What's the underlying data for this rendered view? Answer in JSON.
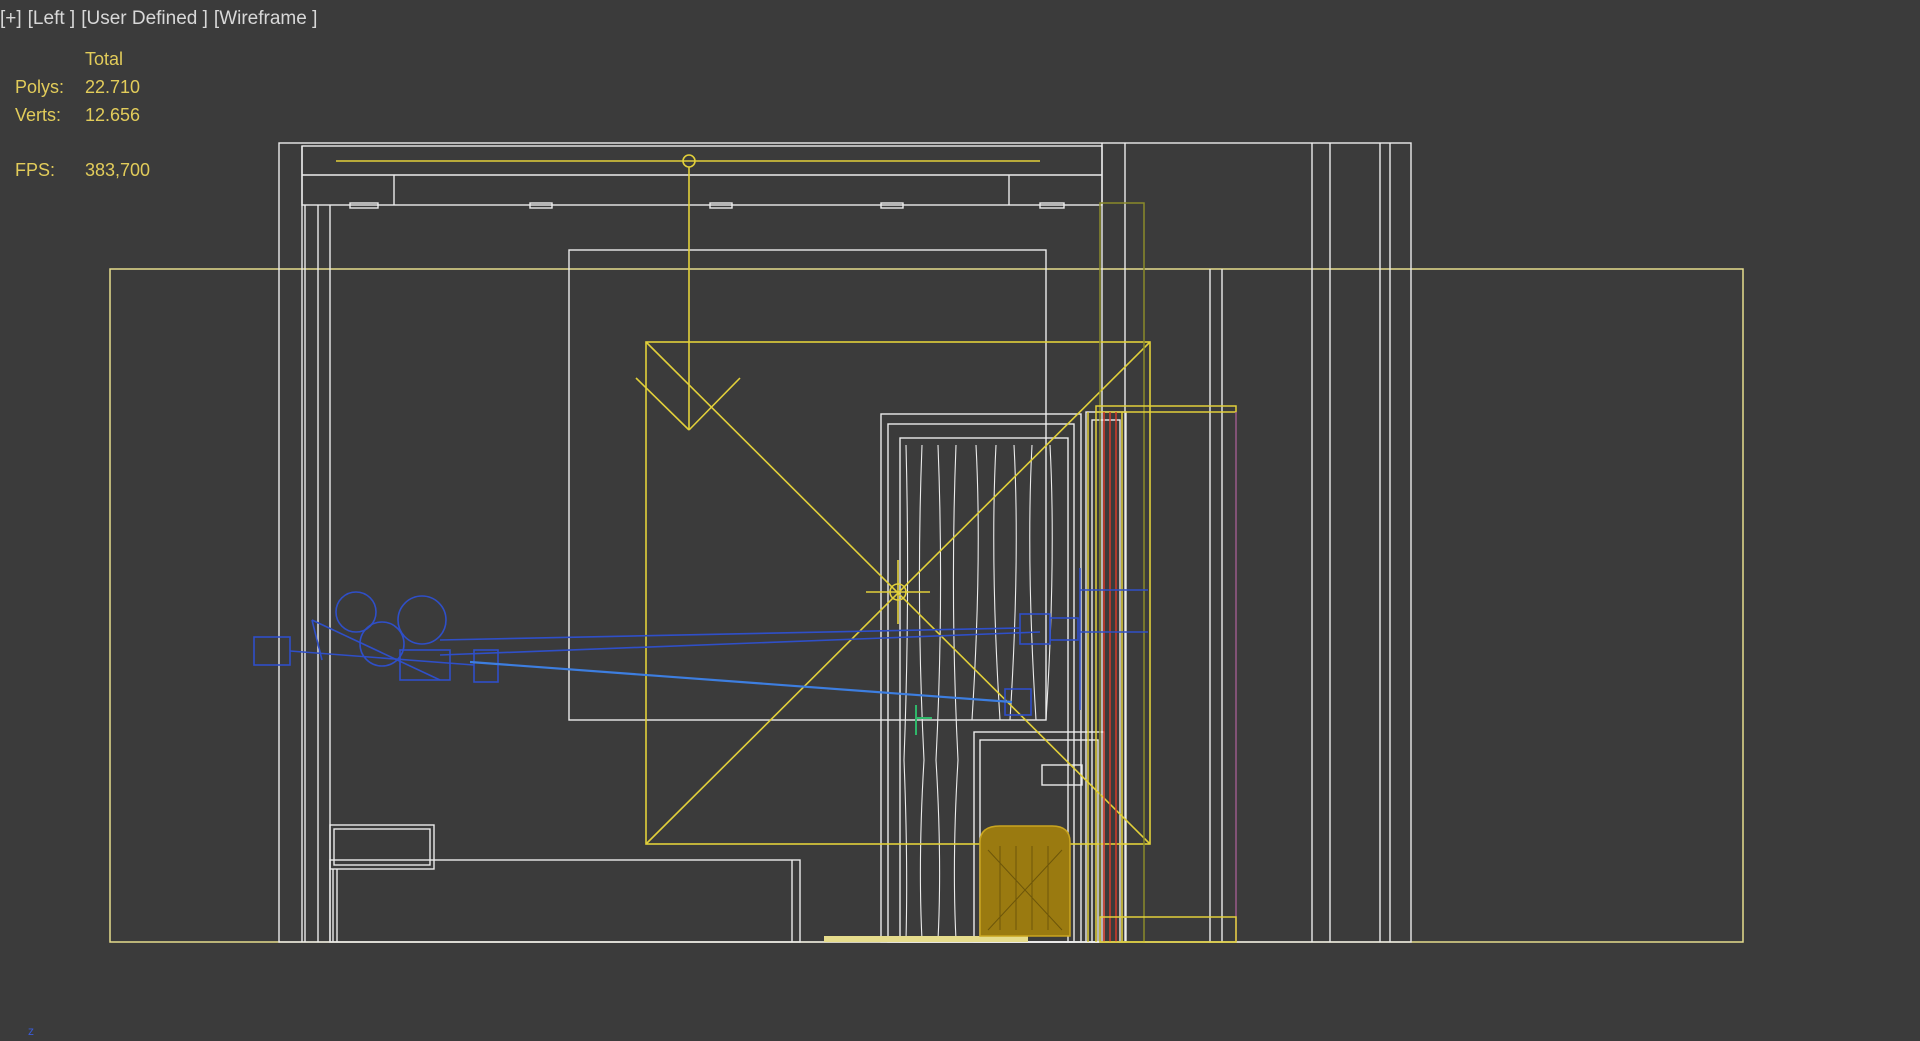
{
  "viewport": {
    "menu_label": "[+]",
    "view_label": "[Left ]",
    "camera_label": "[User Defined ]",
    "shading_label": "[Wireframe ]"
  },
  "stats": {
    "header": "Total",
    "polys_label": "Polys:",
    "polys_value": "22.710",
    "verts_label": "Verts:",
    "verts_value": "12.656",
    "fps_label": "FPS:",
    "fps_value": "383,700"
  },
  "axis": {
    "label": "z"
  },
  "colors": {
    "background": "#3b3b3b",
    "stats_text": "#e2cc5a",
    "wire_white": "#ececec",
    "wire_yellow": "#e2d03a",
    "wire_pale_yellow": "#e6dc8c",
    "wire_blue": "#2f4fc8",
    "wire_light_blue": "#3d7ee0",
    "wire_red": "#d43a2a",
    "wire_olive": "#8a8a2a",
    "object_gold": "#9a7a10",
    "wire_purple": "#9a5a8a"
  },
  "icons": {
    "light_target": "sun-target-icon",
    "camera": "camera-icon"
  }
}
